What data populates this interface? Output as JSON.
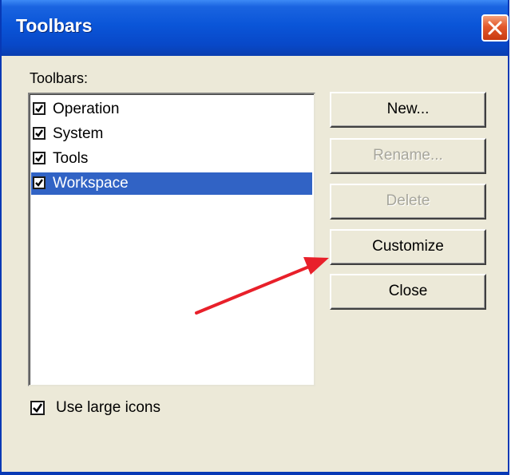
{
  "window": {
    "title": "Toolbars",
    "close_icon": "close-x-icon"
  },
  "list": {
    "label": "Toolbars:",
    "items": [
      {
        "label": "Operation",
        "checked": true,
        "selected": false
      },
      {
        "label": "System",
        "checked": true,
        "selected": false
      },
      {
        "label": "Tools",
        "checked": true,
        "selected": false
      },
      {
        "label": "Workspace",
        "checked": true,
        "selected": true
      }
    ]
  },
  "buttons": {
    "new": {
      "label": "New...",
      "enabled": true
    },
    "rename": {
      "label": "Rename...",
      "enabled": false
    },
    "delete": {
      "label": "Delete",
      "enabled": false
    },
    "customize": {
      "label": "Customize",
      "enabled": true
    },
    "close": {
      "label": "Close",
      "enabled": true
    }
  },
  "options": {
    "use_large_icons": {
      "label": "Use large icons",
      "checked": true
    }
  },
  "annotation": {
    "arrow_color": "#e8202a",
    "arrow_icon": "red-arrow-pointing-to-customize"
  },
  "colors": {
    "title_bar": "#0a55d8",
    "selection": "#3163c5",
    "dialog_face": "#ece9d8",
    "close_button": "#e3582b"
  }
}
